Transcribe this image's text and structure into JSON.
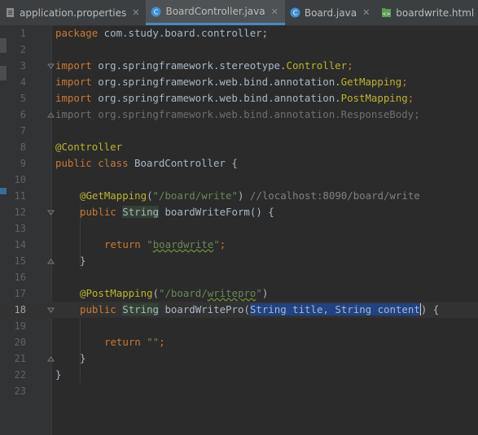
{
  "tabs": [
    {
      "label": "application.properties",
      "icon": "properties-file-icon",
      "active": false
    },
    {
      "label": "BoardController.java",
      "icon": "java-class-icon",
      "active": true
    },
    {
      "label": "Board.java",
      "icon": "java-class-icon",
      "active": false
    },
    {
      "label": "boardwrite.html",
      "icon": "html-file-icon",
      "active": false
    }
  ],
  "gutter": {
    "line_numbers": [
      "1",
      "2",
      "3",
      "4",
      "5",
      "6",
      "7",
      "8",
      "9",
      "10",
      "11",
      "12",
      "13",
      "14",
      "15",
      "16",
      "17",
      "18",
      "19",
      "20",
      "21",
      "22",
      "23"
    ],
    "current_line": "18"
  },
  "code": {
    "l1": {
      "kw": "package",
      "rest": " com.study.board.controller;"
    },
    "l3": {
      "kw": "import",
      "pkg": " org.springframework.stereotype.",
      "cls": "Controller",
      "end": ";"
    },
    "l4": {
      "kw": "import",
      "pkg": " org.springframework.web.bind.annotation.",
      "cls": "GetMapping",
      "end": ";"
    },
    "l5": {
      "kw": "import",
      "pkg": " org.springframework.web.bind.annotation.",
      "cls": "PostMapping",
      "end": ";"
    },
    "l6": {
      "text": "import org.springframework.web.bind.annotation.ResponseBody;"
    },
    "l8": {
      "ann": "@Controller"
    },
    "l9": {
      "kw1": "public",
      "kw2": " class",
      "name": " BoardController {"
    },
    "l11": {
      "ann": "@GetMapping",
      "paren": "(",
      "str": "\"/board/write\"",
      "close": ")",
      "comment": " //localhost:8090/board/write"
    },
    "l12": {
      "kw": "public",
      "type": "String",
      "rest": " boardWriteForm() {"
    },
    "l14": {
      "kw": "return",
      "sp": " ",
      "str1": "\"",
      "str2": "boardwrite",
      "str3": "\"",
      "end": ";"
    },
    "l15": {
      "text": "}"
    },
    "l17": {
      "ann": "@PostMapping",
      "paren": "(",
      "str1": "\"/board/",
      "str2": "writepro",
      "str3": "\"",
      "close": ")"
    },
    "l18": {
      "kw": "public",
      "type": "String",
      "name": " boardWritePro(",
      "p1type": "String",
      "p1name": " title, ",
      "p2type": "String",
      "p2name": " content",
      "after": ") {"
    },
    "l20": {
      "kw": "return",
      "str": " \"\"",
      "end": ";"
    },
    "l21": {
      "text": "}"
    },
    "l22": {
      "text": "}"
    }
  }
}
